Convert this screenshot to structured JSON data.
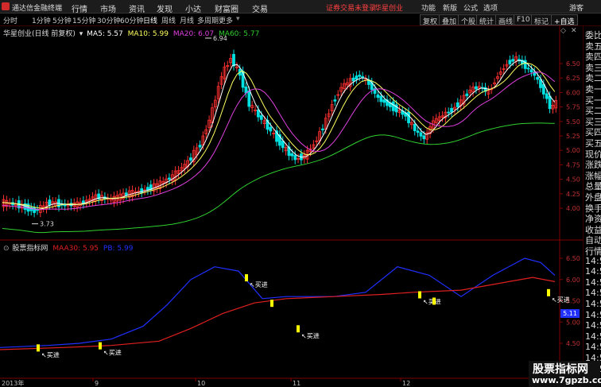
{
  "menubar": {
    "app_title": "通达信金融终端",
    "menus": [
      "行情",
      "市场",
      "资讯",
      "发现",
      "小达",
      "财富圈",
      "交易"
    ],
    "notice": "证券交易未登录",
    "account": "华星创业",
    "right_items": [
      "功能",
      "新版",
      "公式",
      "选项",
      "游客"
    ]
  },
  "periodbar": {
    "periods": [
      "分时",
      "1分钟",
      "5分钟",
      "15分钟",
      "30分钟",
      "60分钟",
      "日线",
      "周线",
      "月线",
      "多周期",
      "更多"
    ],
    "active_period": "日线",
    "tools": [
      "复权",
      "叠加",
      "个股",
      "统计",
      "画线",
      "F10",
      "标记",
      "+自选"
    ]
  },
  "main_chart": {
    "stock_label": "华星创业(日线 前复权)",
    "ma5": "MA5: 5.57",
    "ma10": "MA10: 5.99",
    "ma20": "MA20: 6.07",
    "ma60": "MA60: 5.77",
    "high_marker": "6.94",
    "low_marker": "3.73",
    "y_ticks": [
      "6.50",
      "6.25",
      "6.00",
      "5.75",
      "5.50",
      "5.25",
      "5.00",
      "4.75",
      "4.50",
      "4.25",
      "4.00"
    ]
  },
  "indicator_chart": {
    "name": "股票指标网",
    "maa30": "MAA30: 5.95",
    "pb": "PB: 5.99",
    "value_badge": "5.11",
    "buy_signal": "买进",
    "y_ticks": [
      "6.50",
      "6.00",
      "5.50",
      "5.00",
      "4.50"
    ]
  },
  "x_axis": {
    "labels": [
      "2013年",
      "9",
      "10",
      "11",
      "12"
    ]
  },
  "right_panel": {
    "items": [
      "委比",
      "卖五",
      "卖四",
      "卖三",
      "卖二",
      "卖一",
      "买一",
      "买二",
      "买三",
      "买四",
      "买五",
      "现价",
      "涨跌",
      "涨幅",
      "总量",
      "外盘",
      "换手",
      "净资",
      "收益",
      "自动",
      "行情",
      "14:5",
      "14:5",
      "14:5",
      "14:5",
      "14:5",
      "14:5",
      "14:5",
      "14:5",
      "14:5",
      "14:5",
      "14:5"
    ]
  },
  "watermark": {
    "line1": "股票指标网",
    "line2": "www.7gpzb.com"
  },
  "colors": {
    "up": "#ff3030",
    "down": "#00e0e0",
    "ma5": "#ffffff",
    "ma10": "#ffff60",
    "ma20": "#e040e0",
    "ma60": "#30d030",
    "indicator_blue": "#2030ff",
    "indicator_red": "#e02020",
    "signal_yellow": "#ffff00"
  }
}
